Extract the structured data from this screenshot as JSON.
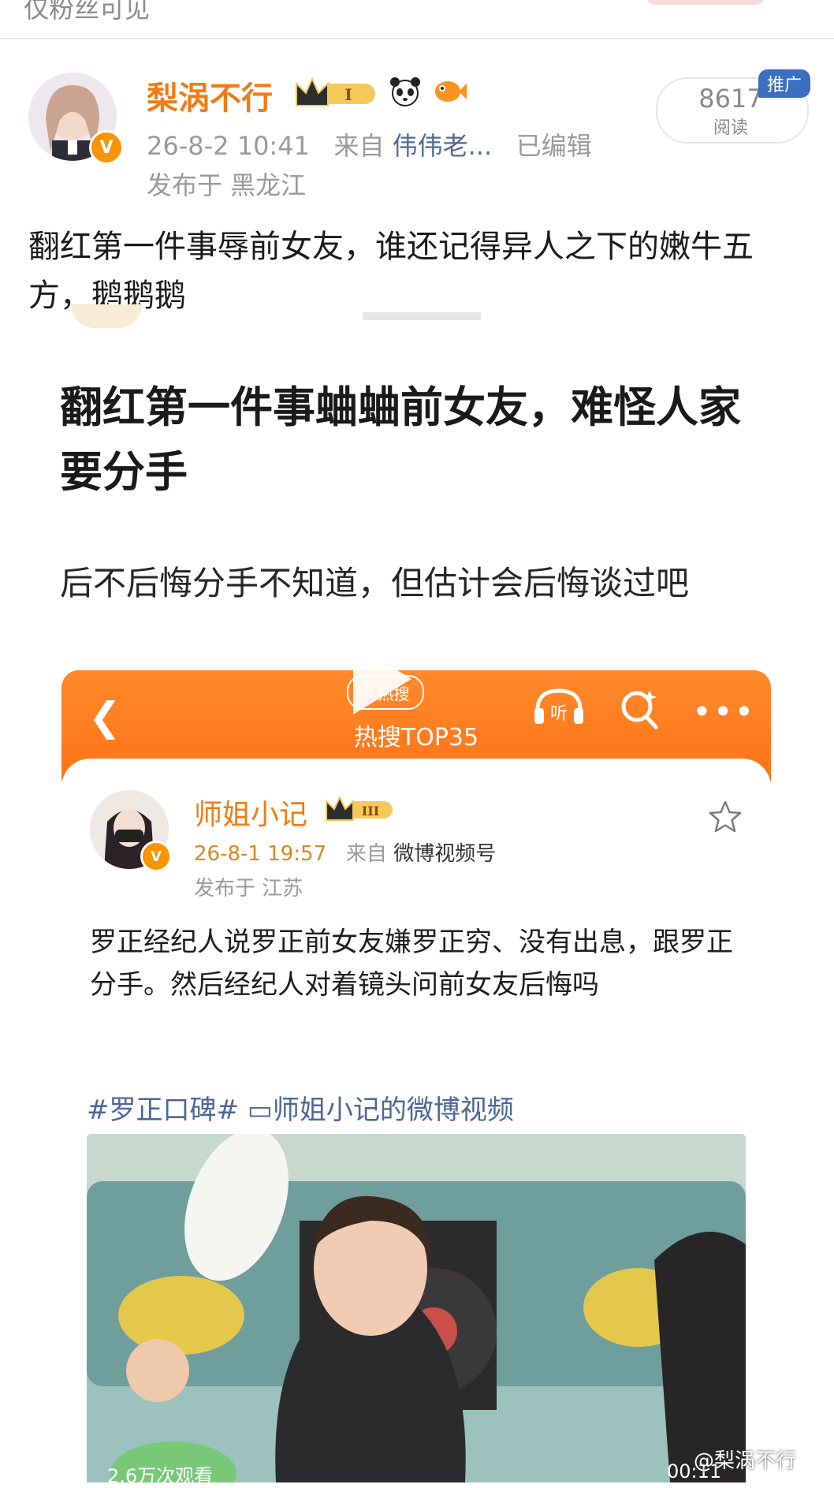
{
  "top_bar": {
    "text": "仅粉丝可见"
  },
  "post": {
    "author": "梨涡不行",
    "time": "26-8-2 10:41",
    "from_label": "来自",
    "source": "伟伟老...",
    "edited": "已编辑",
    "location": "发布于 黑龙江",
    "read_count": "8617",
    "read_label": "阅读",
    "promo_badge": "推广",
    "level_badge": "I",
    "text": "翻红第一件事辱前女友，谁还记得异人之下的嫩牛五方，鹅鹅鹅"
  },
  "article": {
    "title": "翻红第一件事蛐蛐前女友，难怪人家要分手",
    "subtitle": "后不后悔分手不知道，但估计会后悔谈过吧"
  },
  "embedded": {
    "hot_search_pill": "热搜",
    "hot_title": "热搜TOP35",
    "listen_label": "听",
    "author": "师姐小记",
    "level_badge": "III",
    "time": "26-8-1 19:57",
    "from_label": "来自",
    "source": "微博视频号",
    "location": "发布于 江苏",
    "text": "罗正经纪人说罗正前女友嫌罗正穷、没有出息，跟罗正分手。然后经纪人对着镜头问前女友后悔吗",
    "tags": "#罗正口碑# ▭师姐小记的微博视频",
    "video_views": "2.6万次观看",
    "video_duration": "00:11",
    "watermark": "@梨涡不行"
  },
  "colors": {
    "accent_orange": "#ef7c13",
    "link_blue": "#4d6b98",
    "hot_orange": "#ff7a1f",
    "promo_blue": "#3b6fc0"
  }
}
